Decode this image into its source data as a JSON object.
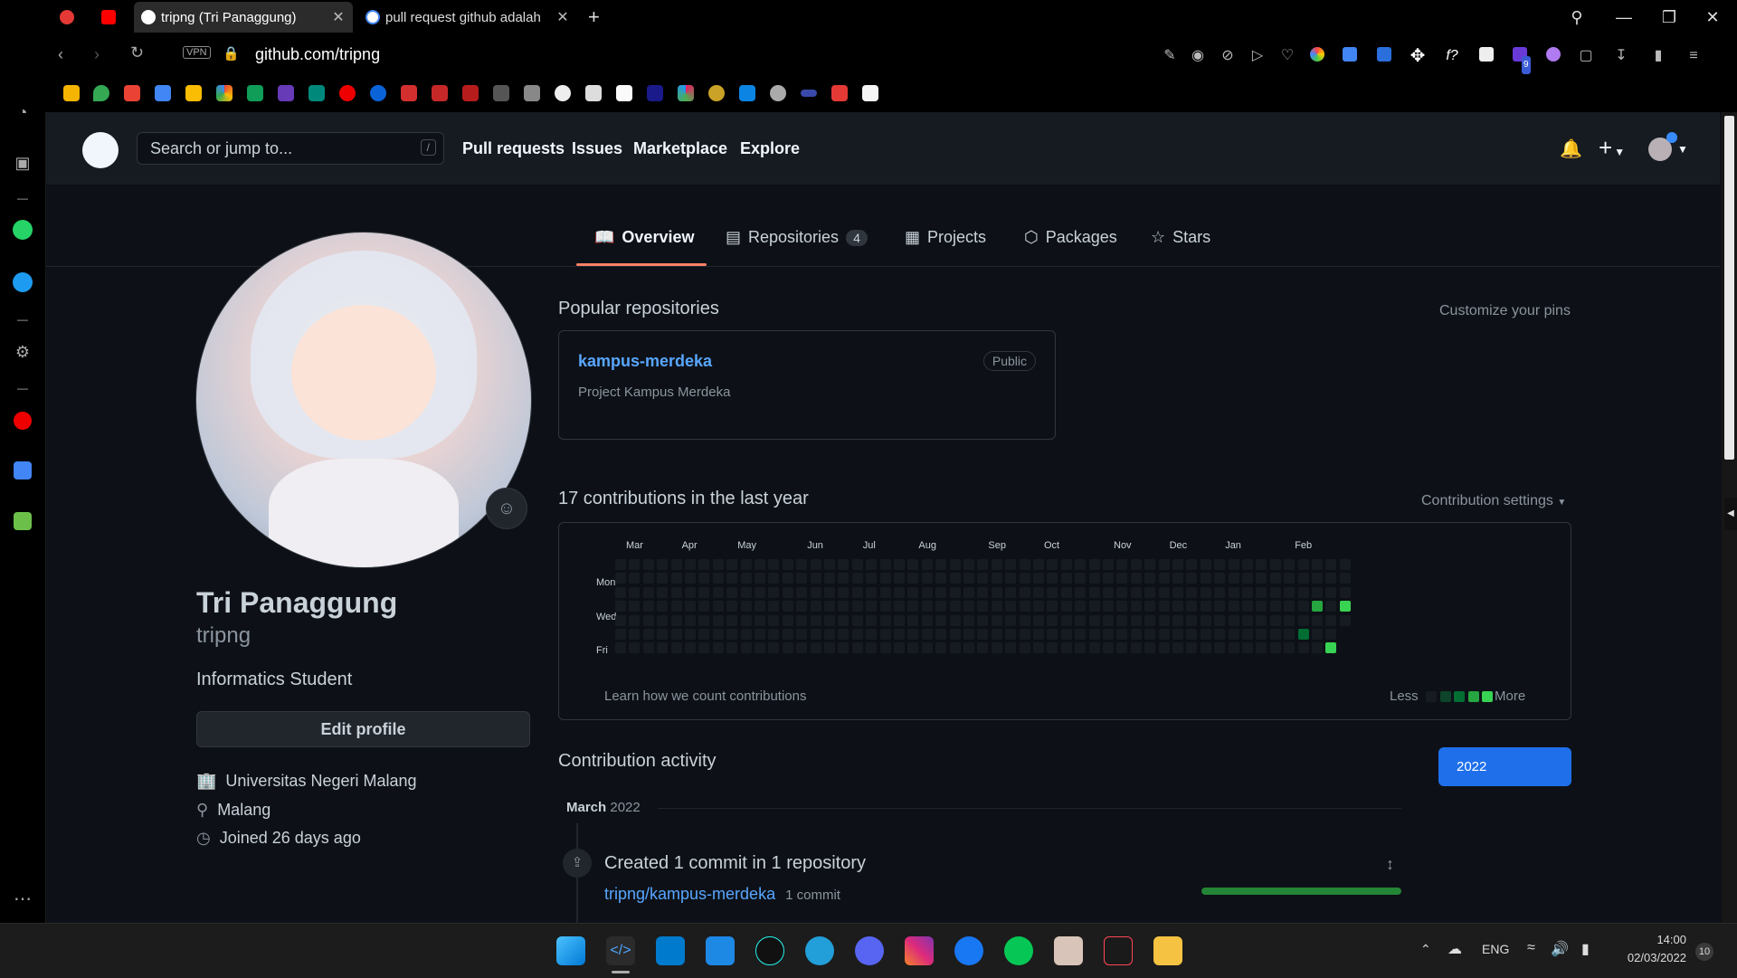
{
  "browser": {
    "tabs": [
      {
        "title": "tripng (Tri Panaggung)",
        "active": true
      },
      {
        "title": "pull request github adalah",
        "active": false
      }
    ],
    "url": "github.com/tripng",
    "vpn_label": "VPN",
    "new_tab": "+",
    "ext_badge": "9"
  },
  "github": {
    "search_placeholder": "Search or jump to...",
    "search_key": "/",
    "nav": [
      "Pull requests",
      "Issues",
      "Marketplace",
      "Explore"
    ],
    "plus": "+"
  },
  "profile_tabs": {
    "overview": "Overview",
    "repositories": "Repositories",
    "repo_count": "4",
    "projects": "Projects",
    "packages": "Packages",
    "stars": "Stars"
  },
  "profile": {
    "name": "Tri Panaggung",
    "username": "tripng",
    "bio": "Informatics Student",
    "edit_button": "Edit profile",
    "organization": "Universitas Negeri Malang",
    "location": "Malang",
    "joined": "Joined 26 days ago"
  },
  "popular": {
    "heading": "Popular repositories",
    "customize": "Customize your pins",
    "repo_name": "kampus-merdeka",
    "visibility": "Public",
    "repo_desc": "Project Kampus Merdeka"
  },
  "contributions": {
    "heading": "17 contributions in the last year",
    "settings": "Contribution settings",
    "months": [
      "Mar",
      "Apr",
      "May",
      "Jun",
      "Jul",
      "Aug",
      "Sep",
      "Oct",
      "Nov",
      "Dec",
      "Jan",
      "Feb"
    ],
    "days": [
      "Mon",
      "Wed",
      "Fri"
    ],
    "learn": "Learn how we count contributions",
    "less": "Less",
    "more": "More",
    "active_cells": [
      {
        "week": 50,
        "day": 3,
        "level": 3
      },
      {
        "week": 49,
        "day": 5,
        "level": 2
      },
      {
        "week": 52,
        "day": 3,
        "level": 4
      },
      {
        "week": 51,
        "day": 6,
        "level": 4
      }
    ],
    "level_colors": [
      "#161b22",
      "#0e4429",
      "#006d32",
      "#26a641",
      "#39d353"
    ]
  },
  "activity": {
    "heading": "Contribution activity",
    "year_button": "2022",
    "month_label": "March",
    "month_year": "2022",
    "created_text": "Created 1 commit in 1 repository",
    "repo_link": "tripng/kampus-merdeka",
    "commit_count": "1 commit",
    "commit_fraction": 1.0
  },
  "taskbar": {
    "lang": "ENG",
    "time": "14:00",
    "date": "02/03/2022",
    "notif_count": "10"
  }
}
